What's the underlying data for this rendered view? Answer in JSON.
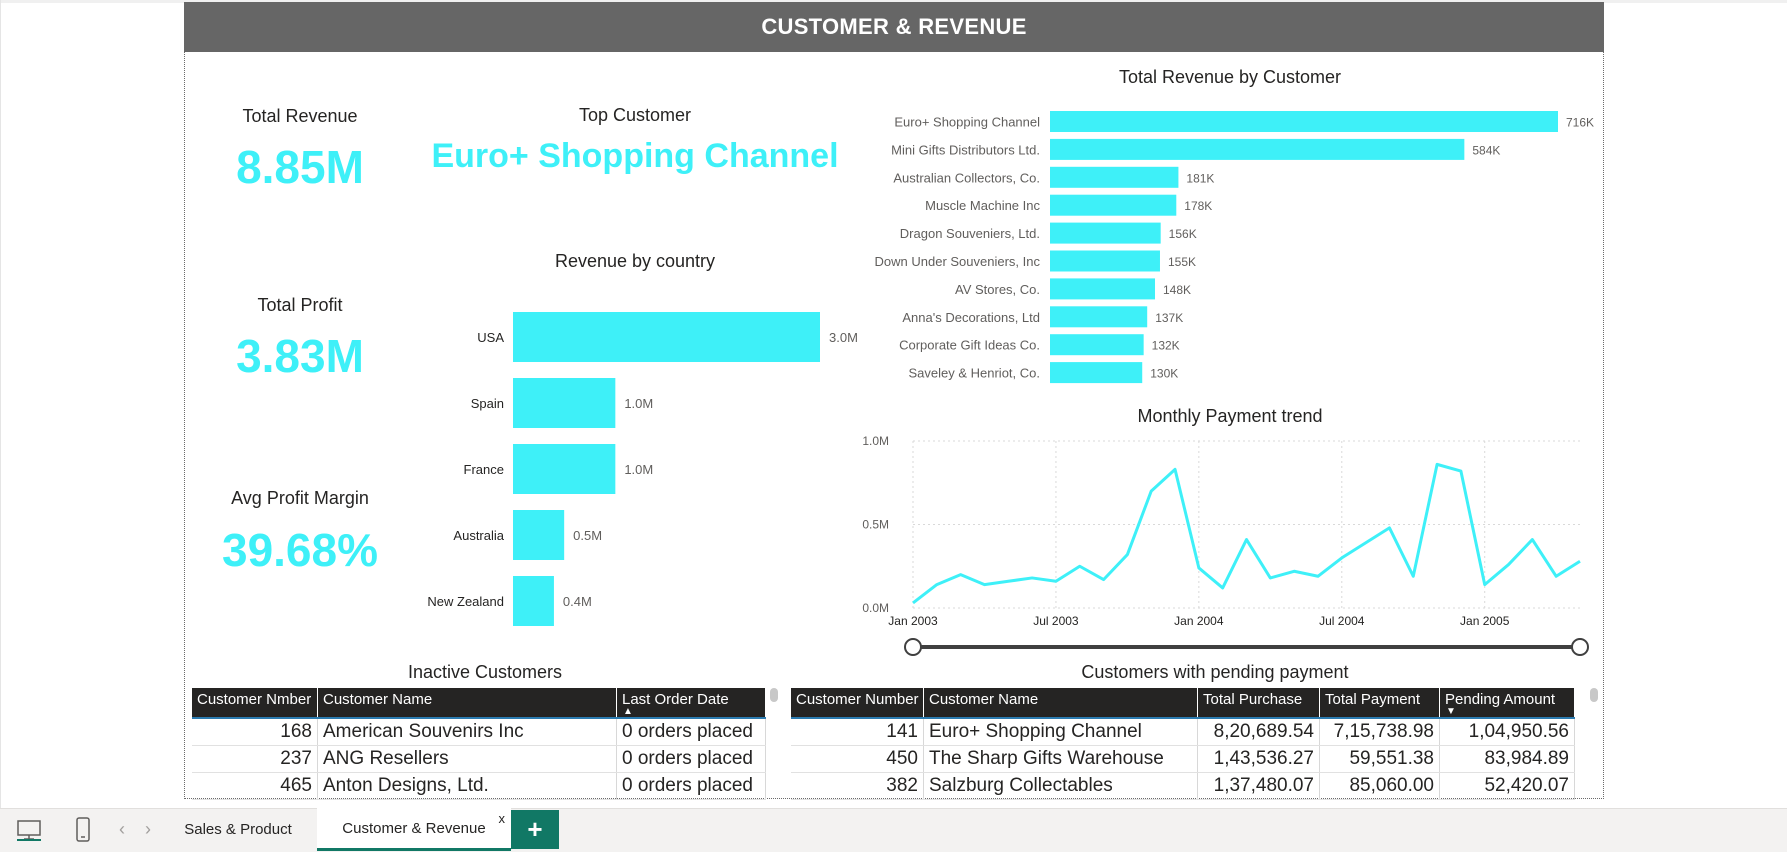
{
  "header": {
    "title": "CUSTOMER & REVENUE"
  },
  "kpis": {
    "total_revenue": {
      "label": "Total Revenue",
      "value": "8.85M"
    },
    "total_profit": {
      "label": "Total Profit",
      "value": "3.83M"
    },
    "avg_profit_margin": {
      "label": "Avg Profit Margin",
      "value": "39.68%"
    },
    "top_customer": {
      "label": "Top Customer",
      "value": "Euro+ Shopping Channel"
    }
  },
  "colors": {
    "accent": "#3ef0f8",
    "header": "#666666",
    "table_header": "#252423",
    "tab_accent": "#117865"
  },
  "chart_data": [
    {
      "id": "revenue_by_country",
      "type": "bar",
      "orientation": "horizontal",
      "title": "Revenue by country",
      "categories": [
        "USA",
        "Spain",
        "France",
        "Australia",
        "New Zealand"
      ],
      "values": [
        3.0,
        1.0,
        1.0,
        0.5,
        0.4
      ],
      "value_labels": [
        "3.0M",
        "1.0M",
        "1.0M",
        "0.5M",
        "0.4M"
      ],
      "xlim": [
        0,
        3.0
      ]
    },
    {
      "id": "revenue_by_customer",
      "type": "bar",
      "orientation": "horizontal",
      "title": "Total Revenue by Customer",
      "categories": [
        "Euro+ Shopping Channel",
        "Mini Gifts Distributors Ltd.",
        "Australian Collectors, Co.",
        "Muscle Machine Inc",
        "Dragon Souveniers, Ltd.",
        "Down Under Souveniers, Inc",
        "AV Stores, Co.",
        "Anna's Decorations, Ltd",
        "Corporate Gift Ideas Co.",
        "Saveley & Henriot, Co."
      ],
      "values": [
        716,
        584,
        181,
        178,
        156,
        155,
        148,
        137,
        132,
        130
      ],
      "value_labels": [
        "716K",
        "584K",
        "181K",
        "178K",
        "156K",
        "155K",
        "148K",
        "137K",
        "132K",
        "130K"
      ],
      "xlim": [
        0,
        716
      ]
    },
    {
      "id": "monthly_payment_trend",
      "type": "line",
      "title": "Monthly Payment trend",
      "x": [
        "2003-01",
        "2003-02",
        "2003-03",
        "2003-04",
        "2003-05",
        "2003-06",
        "2003-07",
        "2003-08",
        "2003-09",
        "2003-10",
        "2003-11",
        "2003-12",
        "2004-01",
        "2004-02",
        "2004-03",
        "2004-04",
        "2004-05",
        "2004-06",
        "2004-07",
        "2004-08",
        "2004-09",
        "2004-10",
        "2004-11",
        "2004-12",
        "2005-01",
        "2005-02",
        "2005-03",
        "2005-04",
        "2005-05"
      ],
      "values": [
        0.03,
        0.14,
        0.2,
        0.14,
        0.16,
        0.18,
        0.16,
        0.25,
        0.17,
        0.32,
        0.7,
        0.83,
        0.24,
        0.12,
        0.41,
        0.18,
        0.22,
        0.19,
        0.3,
        0.39,
        0.48,
        0.19,
        0.86,
        0.82,
        0.14,
        0.26,
        0.41,
        0.19,
        0.28
      ],
      "x_ticks": [
        "Jan 2003",
        "Jul 2003",
        "Jan 2004",
        "Jul 2004",
        "Jan 2005"
      ],
      "y_ticks": [
        "0.0M",
        "0.5M",
        "1.0M"
      ],
      "ylim": [
        0,
        1.0
      ],
      "grid": true
    }
  ],
  "inactive_table": {
    "title": "Inactive Customers",
    "columns": [
      "Customer Nmber",
      "Customer Name",
      "Last Order Date"
    ],
    "rows": [
      [
        "168",
        "American Souvenirs Inc",
        "0 orders placed"
      ],
      [
        "237",
        "ANG Resellers",
        "0 orders placed"
      ],
      [
        "465",
        "Anton Designs, Ltd.",
        "0 orders placed"
      ]
    ]
  },
  "pending_table": {
    "title": "Customers with pending payment",
    "columns": [
      "Customer Number",
      "Customer Name",
      "Total Purchase",
      "Total Payment",
      "Pending Amount"
    ],
    "rows": [
      [
        "141",
        "Euro+ Shopping Channel",
        "8,20,689.54",
        "7,15,738.98",
        "1,04,950.56"
      ],
      [
        "450",
        "The Sharp Gifts Warehouse",
        "1,43,536.27",
        "59,551.38",
        "83,984.89"
      ],
      [
        "382",
        "Salzburg Collectables",
        "1,37,480.07",
        "85,060.00",
        "52,420.07"
      ]
    ]
  },
  "tabs": [
    {
      "label": "Sales & Product"
    },
    {
      "label": "Customer & Revenue",
      "close": "x"
    }
  ],
  "add_tab_label": "+",
  "nav": {
    "prev": "‹",
    "next": "›"
  }
}
